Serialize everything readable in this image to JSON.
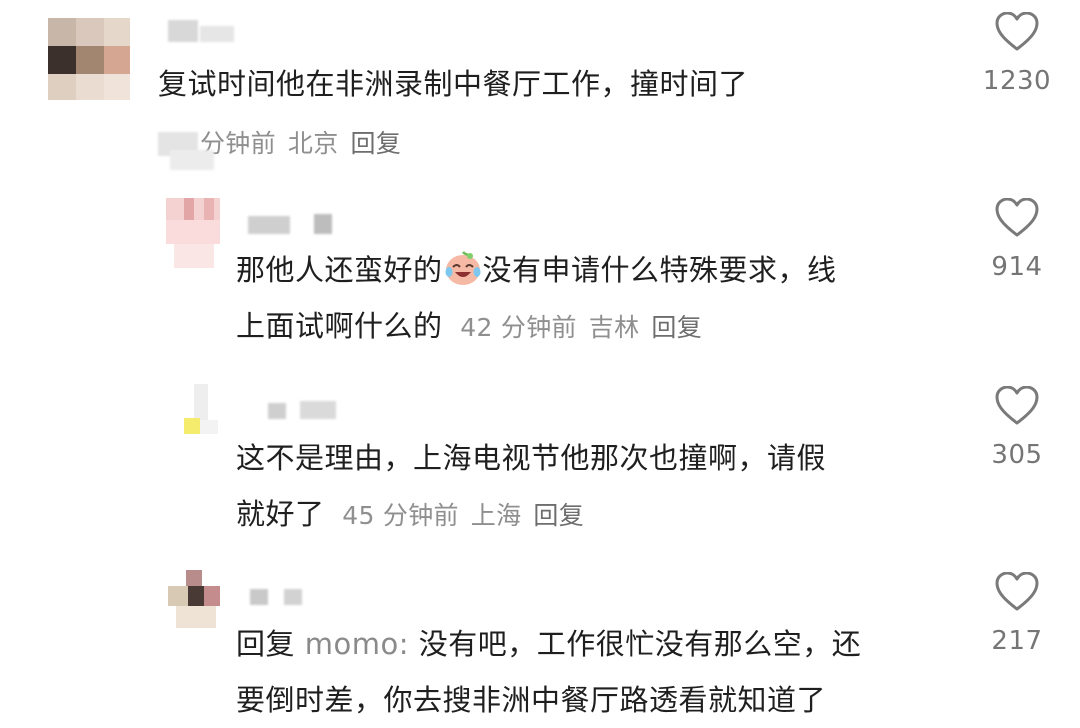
{
  "comments": [
    {
      "text": "复试时间他在非洲录制中餐厅工作，撞时间了",
      "time": "分钟前",
      "location": "北京",
      "reply_label": "回复",
      "likes": "1230",
      "icon": "heart-outline-icon"
    },
    {
      "text_line1a": "那他人还蛮好的",
      "text_line1b": "没有申请什么特殊要求，线",
      "text_line2": "上面试啊什么的",
      "time": "42 分钟前",
      "location": "吉林",
      "reply_label": "回复",
      "likes": "914",
      "emoji": "crying-laughing-emoji",
      "icon": "heart-outline-icon"
    },
    {
      "text_line1": "这不是理由，上海电视节他那次也撞啊，请假",
      "text_line2": "就好了",
      "time": "45 分钟前",
      "location": "上海",
      "reply_label": "回复",
      "likes": "305",
      "icon": "heart-outline-icon"
    },
    {
      "reply_prefix": "回复",
      "mention": "momo:",
      "text_line1": "没有吧，工作很忙没有那么空，还",
      "text_line2": "要倒时差，你去搜非洲中餐厅路透看就知道了",
      "likes": "217",
      "icon": "heart-outline-icon"
    }
  ],
  "colors": {
    "text": "#1f1f1f",
    "meta": "#8f8f8f",
    "count": "#757575",
    "heart": "#7a7a7a"
  }
}
